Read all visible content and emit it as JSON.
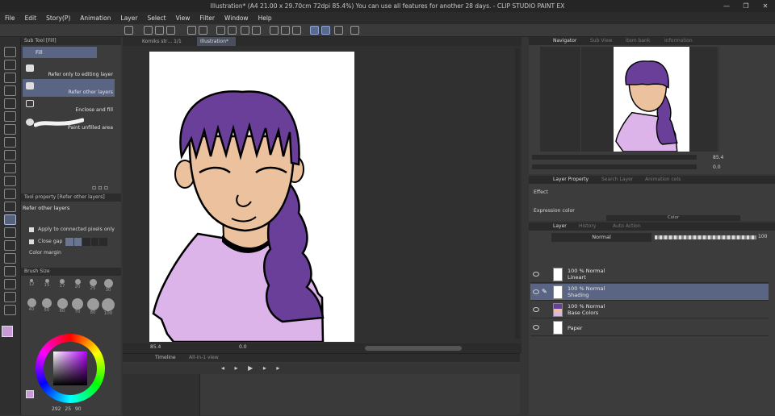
{
  "title_bar": {
    "text": "Illustration* (A4 21.00 x 29.70cm 72dpi 85.4%)  You can use all features for another 28 days. - CLIP STUDIO PAINT EX",
    "minimize": "—",
    "maximize": "❐",
    "close": "✕"
  },
  "menu": [
    "File",
    "Edit",
    "Story(P)",
    "Animation",
    "Layer",
    "Select",
    "View",
    "Filter",
    "Window",
    "Help"
  ],
  "doc_tabs": [
    "Komiks str… 1/1",
    "Illustration*"
  ],
  "sub_tool": {
    "header": "Sub Tool [Fill]",
    "tab": "Fill",
    "items": [
      "Refer only to editing layer",
      "Refer other layers",
      "Enclose and fill",
      "Paint unfilled area"
    ],
    "selected": "Refer other layers"
  },
  "tool_property": {
    "header": "Tool property [Refer other layers]",
    "name": "Refer other layers",
    "apply_connected": "Apply to connected pixels only",
    "close_gap": "Close gap",
    "color_margin": "Color margin"
  },
  "brush_size": {
    "header": "Brush Size",
    "sizes": [
      "12",
      "15",
      "17",
      "20",
      "25",
      "30",
      "40",
      "50",
      "60",
      "70",
      "80",
      "100"
    ]
  },
  "color": {
    "values": [
      "292",
      "25",
      "90"
    ],
    "fg": "#c89bd8",
    "bg": "#ffffff"
  },
  "canvas": {
    "zoom": "85.4",
    "angle": "0.0"
  },
  "timeline": {
    "tab1": "Timeline",
    "tab2": "All-in-1 view"
  },
  "navigator": {
    "tabs": [
      "Navigator",
      "Sub View",
      "Item bank",
      "Information"
    ],
    "zoom": "85.4",
    "angle": "0.0"
  },
  "layer_property": {
    "tabs": [
      "Layer Property",
      "Search Layer",
      "Animation cels"
    ],
    "effect": "Effect",
    "expression_color": "Expression color",
    "color_label": "Color"
  },
  "layer_panel": {
    "tabs": [
      "Layer",
      "History",
      "Auto Action"
    ],
    "blend": "Normal",
    "opacity": "100",
    "layers": [
      {
        "opacity": "100 % Normal",
        "name": "Lineart"
      },
      {
        "opacity": "100 % Normal",
        "name": "Shading"
      },
      {
        "opacity": "100 % Normal",
        "name": "Base Colors"
      },
      {
        "opacity": "",
        "name": "Paper"
      }
    ],
    "selected": "Shading"
  },
  "colors": {
    "accent": "#5a6584",
    "hair": "#6a3f9a",
    "skin": "#ecc29e",
    "shirt": "#ddb4ea"
  }
}
